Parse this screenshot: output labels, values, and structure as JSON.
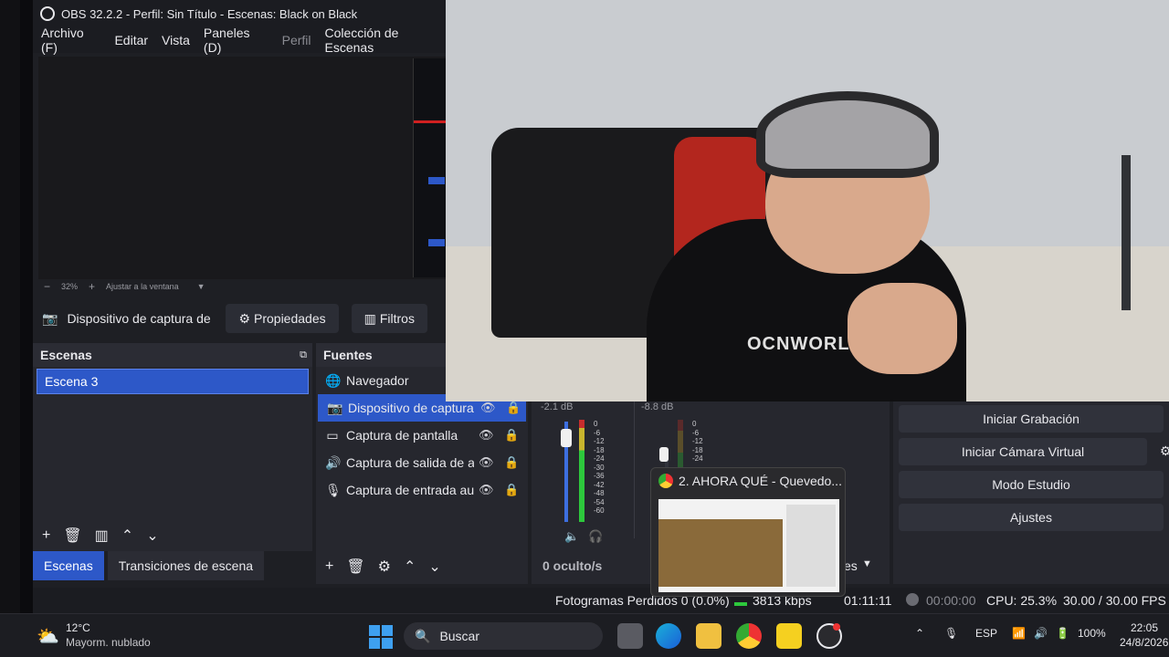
{
  "window": {
    "title": "OBS 32.2.2 - Perfil: Sin Título - Escenas: Black on Black"
  },
  "menu": [
    "Archivo (F)",
    "Editar",
    "Vista",
    "Paneles (D)",
    "Perfil",
    "Colección de Escenas"
  ],
  "preview": {
    "zoom": "32%",
    "fit_label": "Ajustar a la ventana"
  },
  "source_toolbar": {
    "selected_source": "Dispositivo de captura de v",
    "properties": "Propiedades",
    "filters": "Filtros"
  },
  "scenes": {
    "title": "Escenas",
    "items": [
      "Escena 3"
    ]
  },
  "sources": {
    "title": "Fuentes",
    "items": [
      {
        "icon": "globe-icon",
        "label": "Navegador"
      },
      {
        "icon": "camera-icon",
        "label": "Dispositivo de captura"
      },
      {
        "icon": "monitor-icon",
        "label": "Captura de pantalla"
      },
      {
        "icon": "speaker-icon",
        "label": "Captura de salida de au"
      },
      {
        "icon": "microphone-icon",
        "label": "Captura de entrada aud"
      }
    ]
  },
  "bottom_tabs": [
    "Escenas",
    "Transiciones de escena"
  ],
  "mixer": {
    "channel1_db": "-2.1 dB",
    "channel2_db": "-8.8 dB",
    "scale": [
      "0",
      "-6",
      "-12",
      "-18",
      "-24",
      "-30",
      "-36",
      "-42",
      "-48",
      "-54",
      "-60"
    ],
    "hidden_label": "0 oculto/s"
  },
  "controls": {
    "buttons": [
      "Iniciar Grabación",
      "Iniciar Cámara Virtual",
      "Modo Estudio",
      "Ajustes"
    ],
    "partial_label": "es"
  },
  "status": {
    "dropped_frames": "Fotogramas Perdidos 0 (0.0%)",
    "bitrate": "3813 kbps",
    "stream_time": "01:11:11",
    "rec_time": "00:00:00",
    "cpu": "CPU: 25.3%",
    "fps": "30.00 / 30.00 FPS"
  },
  "webcam": {
    "shirt_text": "OCNWORLD"
  },
  "thumbnail": {
    "title": "2. AHORA QUÉ - Quevedo..."
  },
  "taskbar": {
    "temperature": "12°C",
    "weather": "Mayorm. nublado",
    "search_placeholder": "Buscar",
    "lang": "ESP",
    "battery": "100%",
    "time": "22:05",
    "date": "24/8/2026"
  }
}
